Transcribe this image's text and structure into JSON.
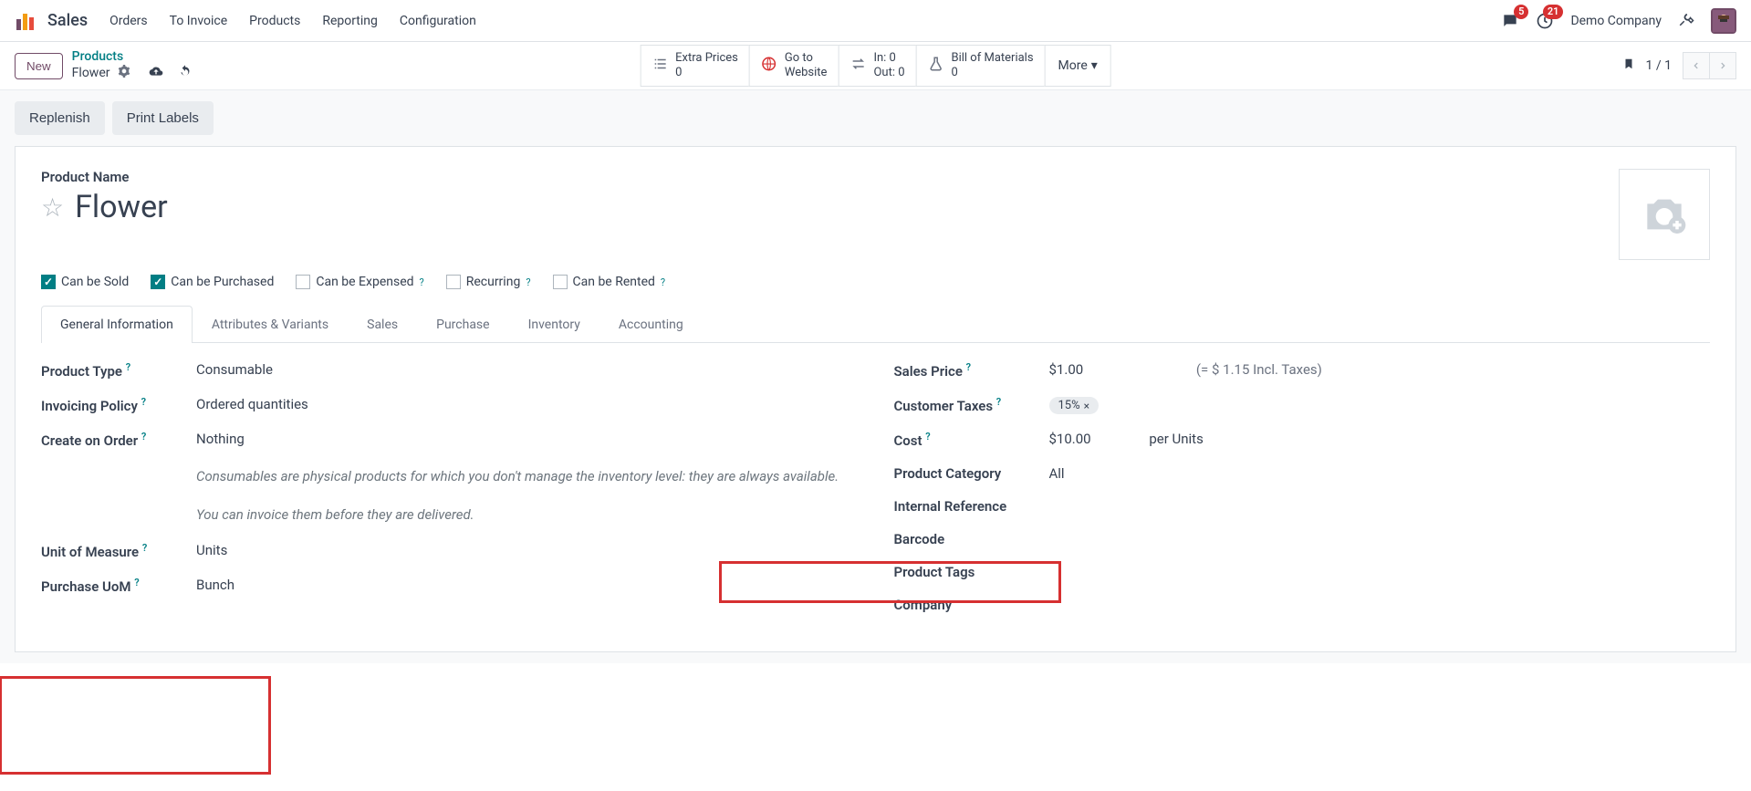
{
  "topnav": {
    "brand": "Sales",
    "menu": [
      "Orders",
      "To Invoice",
      "Products",
      "Reporting",
      "Configuration"
    ],
    "msg_badge": "5",
    "activity_badge": "21",
    "company": "Demo Company"
  },
  "controls": {
    "new_label": "New",
    "breadcrumb_parent": "Products",
    "breadcrumb_current": "Flower",
    "stats": {
      "extra_prices": {
        "label": "Extra Prices",
        "value": "0"
      },
      "go_to": {
        "label": "Go to",
        "value": "Website"
      },
      "in": {
        "label": "In: 0"
      },
      "out": {
        "label": "Out: 0"
      },
      "bom": {
        "label": "Bill of Materials",
        "value": "0"
      }
    },
    "more": "More",
    "pager": "1 / 1"
  },
  "actions": {
    "replenish": "Replenish",
    "print_labels": "Print Labels"
  },
  "form": {
    "product_name_label": "Product Name",
    "product_name": "Flower",
    "checks": {
      "can_be_sold": "Can be Sold",
      "can_be_purchased": "Can be Purchased",
      "can_be_expensed": "Can be Expensed",
      "recurring": "Recurring",
      "can_be_rented": "Can be Rented"
    },
    "tabs": [
      "General Information",
      "Attributes & Variants",
      "Sales",
      "Purchase",
      "Inventory",
      "Accounting"
    ],
    "left": {
      "product_type": {
        "label": "Product Type",
        "value": "Consumable"
      },
      "invoicing_policy": {
        "label": "Invoicing Policy",
        "value": "Ordered quantities"
      },
      "create_on_order": {
        "label": "Create on Order",
        "value": "Nothing"
      },
      "note1": "Consumables are physical products for which you don't manage the inventory level: they are always available.",
      "note2": "You can invoice them before they are delivered.",
      "uom": {
        "label": "Unit of Measure",
        "value": "Units"
      },
      "purchase_uom": {
        "label": "Purchase UoM",
        "value": "Bunch"
      }
    },
    "right": {
      "sales_price": {
        "label": "Sales Price",
        "value": "$1.00",
        "incl": "(= $ 1.15 Incl. Taxes)"
      },
      "customer_taxes": {
        "label": "Customer Taxes",
        "value": "15%"
      },
      "cost": {
        "label": "Cost",
        "value": "$10.00",
        "per": "per Units"
      },
      "product_category": {
        "label": "Product Category",
        "value": "All"
      },
      "internal_reference": {
        "label": "Internal Reference"
      },
      "barcode": {
        "label": "Barcode"
      },
      "product_tags": {
        "label": "Product Tags"
      },
      "company": {
        "label": "Company"
      }
    }
  }
}
